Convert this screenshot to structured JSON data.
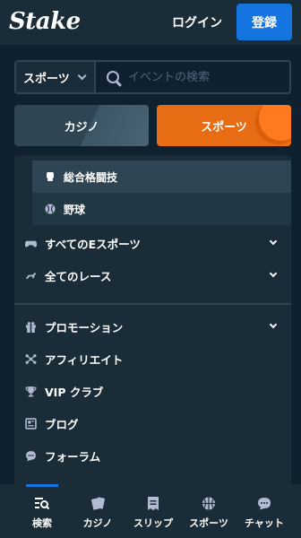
{
  "header": {
    "logo": "Stake",
    "login_label": "ログイン",
    "register_label": "登録"
  },
  "search": {
    "category_value": "スポーツ",
    "placeholder": "イベントの検索"
  },
  "tabs": {
    "casino_label": "カジノ",
    "sports_label": "スポーツ"
  },
  "sidebar": {
    "sub_items": [
      {
        "label": "総合格闘技",
        "icon": "mma-glove-icon",
        "active": true
      },
      {
        "label": "野球",
        "icon": "baseball-icon",
        "active": false
      }
    ],
    "items": [
      {
        "label": "すべてのEスポーツ",
        "icon": "gamepad-icon",
        "expandable": true
      },
      {
        "label": "全てのレース",
        "icon": "horse-racing-icon",
        "expandable": true
      },
      {
        "label": "プロモーション",
        "icon": "gift-icon",
        "expandable": true
      },
      {
        "label": "アフィリエイト",
        "icon": "affiliate-icon",
        "expandable": false
      },
      {
        "label": "VIP クラブ",
        "icon": "trophy-icon",
        "expandable": false
      },
      {
        "label": "ブログ",
        "icon": "blog-icon",
        "expandable": false
      },
      {
        "label": "フォーラム",
        "icon": "chat-bubble-icon",
        "expandable": false
      }
    ]
  },
  "bottom_nav": {
    "items": [
      {
        "label": "検索",
        "icon": "browse-icon",
        "active": true
      },
      {
        "label": "カジノ",
        "icon": "cards-icon",
        "active": false
      },
      {
        "label": "スリップ",
        "icon": "bet-slip-icon",
        "active": false
      },
      {
        "label": "スポーツ",
        "icon": "basketball-icon",
        "active": false
      },
      {
        "label": "チャット",
        "icon": "chat-icon",
        "active": false
      }
    ]
  },
  "colors": {
    "background": "#0f212e",
    "panel": "#1a2c38",
    "accent_blue": "#1475e1",
    "accent_orange": "#e86c14",
    "muted_icon": "#b1bad3"
  }
}
